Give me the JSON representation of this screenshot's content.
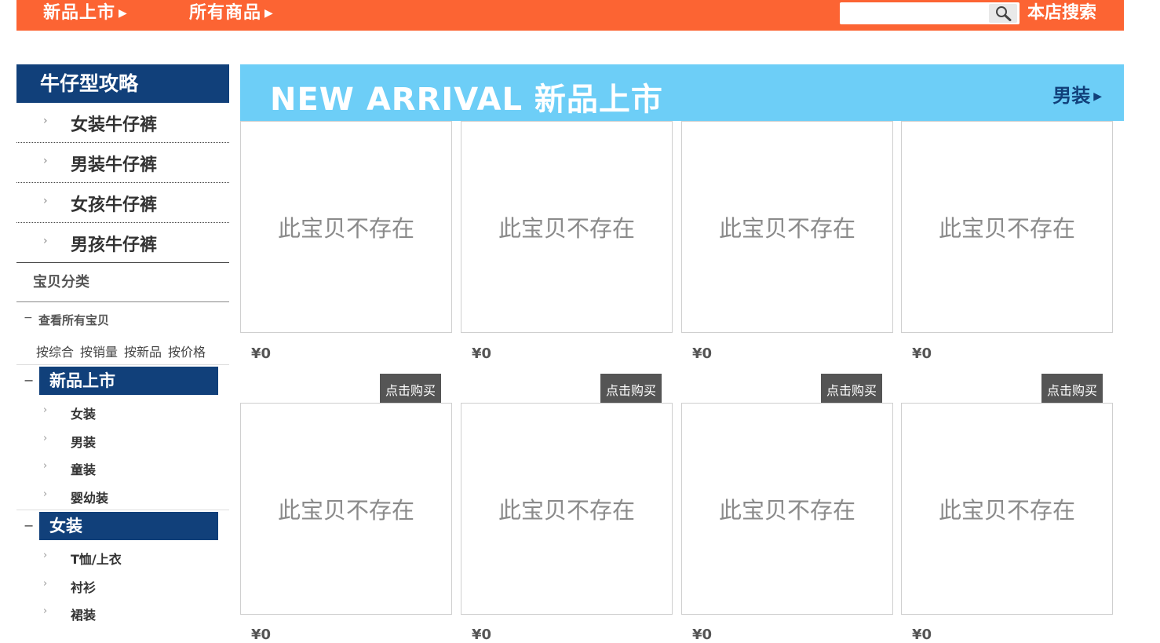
{
  "topbar": {
    "nav": [
      {
        "label": "新品上市"
      },
      {
        "label": "所有商品"
      }
    ],
    "search_placeholder": "",
    "search_label": "本店搜索",
    "accent_color": "#fc6433"
  },
  "sidebar": {
    "guide_title": "牛仔型攻略",
    "guide_items": [
      "女装牛仔裤",
      "男装牛仔裤",
      "女孩牛仔裤",
      "男孩牛仔裤"
    ],
    "category_title": "宝贝分类",
    "view_all": "查看所有宝贝",
    "sort_links": [
      "按综合",
      "按销量",
      "按新品",
      "按价格"
    ],
    "groups": [
      {
        "title": "新品上市",
        "items": [
          "女装",
          "男装",
          "童装",
          "婴幼装"
        ]
      },
      {
        "title": "女装",
        "items": [
          "T恤/上衣",
          "衬衫",
          "裙装"
        ]
      }
    ],
    "header_color": "#11407a"
  },
  "banner": {
    "title": "NEW ARRIVAL 新品上市",
    "link": "男装",
    "color": "#6dcef7"
  },
  "products": [
    {
      "placeholder": "此宝贝不存在",
      "price": "¥0",
      "buy": "点击购买"
    },
    {
      "placeholder": "此宝贝不存在",
      "price": "¥0",
      "buy": "点击购买"
    },
    {
      "placeholder": "此宝贝不存在",
      "price": "¥0",
      "buy": "点击购买"
    },
    {
      "placeholder": "此宝贝不存在",
      "price": "¥0",
      "buy": "点击购买"
    },
    {
      "placeholder": "此宝贝不存在",
      "price": "¥0"
    },
    {
      "placeholder": "此宝贝不存在",
      "price": "¥0"
    },
    {
      "placeholder": "此宝贝不存在",
      "price": "¥0"
    },
    {
      "placeholder": "此宝贝不存在",
      "price": "¥0"
    }
  ]
}
